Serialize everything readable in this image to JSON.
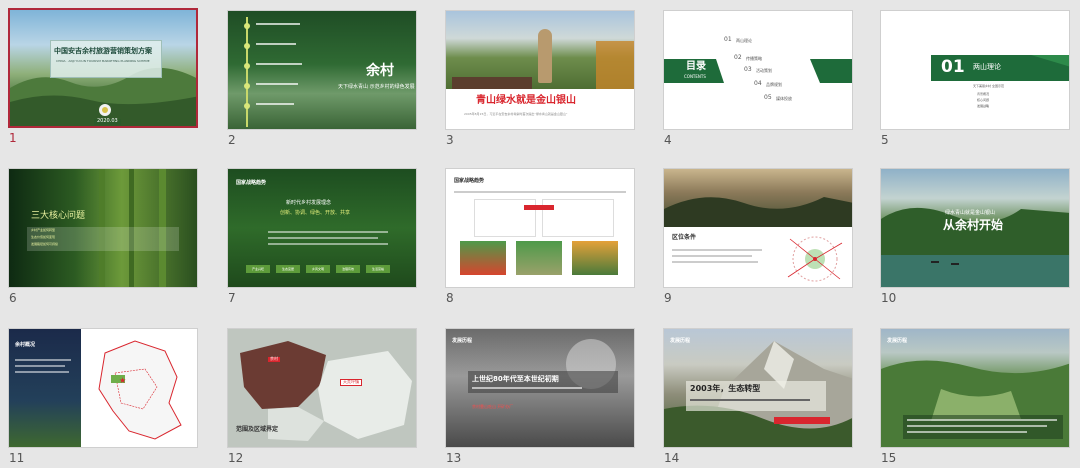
{
  "slides": [
    {
      "num": "1",
      "title": "中国安吉余村旅游营销策划方案",
      "subtitle": "CHINA · ANJI YUCUN TOURISM MARKETING PLANNING SCHEME",
      "badge": "2020.03"
    },
    {
      "num": "2",
      "title": "余村",
      "subtitle": "天下绿水青山 示范乡村的绿色发展"
    },
    {
      "num": "3",
      "caption": "青山绿水就是金山银山",
      "note": "2005年8月15日，习近平在安吉余村考察时首次提出“绿水青山就是金山银山”"
    },
    {
      "num": "4",
      "title": "目录",
      "subtitle": "CONTENTS",
      "items": [
        {
          "n": "01",
          "label": "两山理论"
        },
        {
          "n": "02",
          "label": "传播策略"
        },
        {
          "n": "03",
          "label": "活动策划"
        },
        {
          "n": "04",
          "label": "品牌规划"
        },
        {
          "n": "05",
          "label": "媒体投放"
        }
      ]
    },
    {
      "num": "5",
      "n": "01",
      "title": "两山理论",
      "subtitle": "天下美丽乡村 全国示范",
      "items": [
        "背景概况",
        "核心问题",
        "发展战略"
      ]
    },
    {
      "num": "6",
      "title": "三大核心问题",
      "items": [
        "乡村产业如何转型",
        "生态价值如何变现",
        "发展路径如何可持续"
      ]
    },
    {
      "num": "7",
      "title": "国家战略趋势",
      "highlight": "新时代乡村发展理念",
      "keywords": "创新、协调、绿色、开放、共享",
      "tags": [
        "产业兴旺",
        "生态宜居",
        "乡风文明",
        "治理有效",
        "生活富裕"
      ]
    },
    {
      "num": "8",
      "title": "国家战略趋势"
    },
    {
      "num": "9",
      "title": "区位条件"
    },
    {
      "num": "10",
      "title": "绿水青山就是金山银山",
      "subtitle": "从余村开始"
    },
    {
      "num": "11",
      "title": "余村概况"
    },
    {
      "num": "12",
      "title": "范围及区域界定",
      "labels": [
        "余村",
        "天荒坪镇"
      ]
    },
    {
      "num": "13",
      "header": "发展历程",
      "title": "上世纪80年代至本世纪初期",
      "subtitle": "余村靠山吃山 开矿办厂"
    },
    {
      "num": "14",
      "header": "发展历程",
      "title": "2003年，生态转型"
    },
    {
      "num": "15",
      "header": "发展历程"
    }
  ],
  "colors": {
    "accent": "#1e6b3a",
    "selection": "#b0283a",
    "red_text": "#d9262e"
  }
}
